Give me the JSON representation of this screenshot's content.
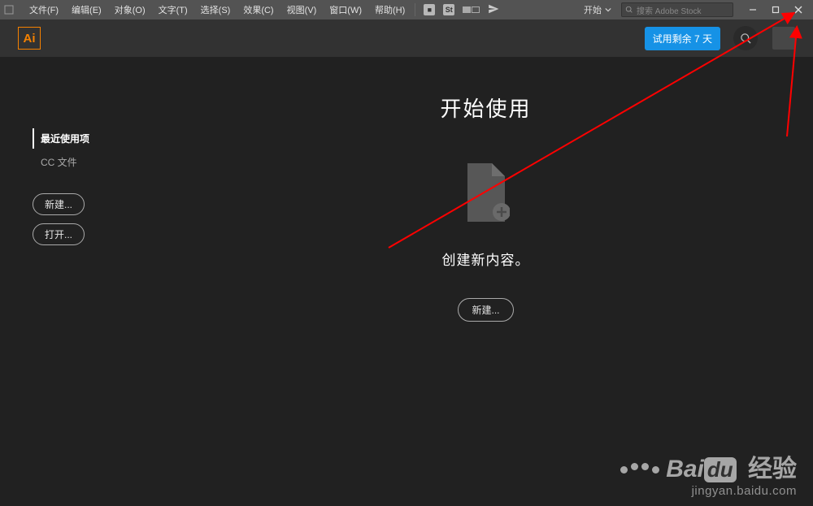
{
  "menubar": {
    "items": [
      "文件(F)",
      "编辑(E)",
      "对象(O)",
      "文字(T)",
      "选择(S)",
      "效果(C)",
      "视图(V)",
      "窗口(W)",
      "帮助(H)"
    ],
    "workspace_label": "开始",
    "stock_placeholder": "搜索 Adobe Stock"
  },
  "header": {
    "logo_text": "Ai",
    "trial_label": "试用剩余 7 天"
  },
  "sidebar": {
    "nav": [
      {
        "label": "最近使用项",
        "active": true
      },
      {
        "label": "CC 文件",
        "active": false
      }
    ],
    "new_btn": "新建...",
    "open_btn": "打开..."
  },
  "content": {
    "headline": "开始使用",
    "caption": "创建新内容。",
    "new_btn": "新建..."
  },
  "watermark": {
    "brand_prefix": "Bai",
    "brand_box": "du",
    "brand_suffix": "经验",
    "url": "jingyan.baidu.com"
  }
}
